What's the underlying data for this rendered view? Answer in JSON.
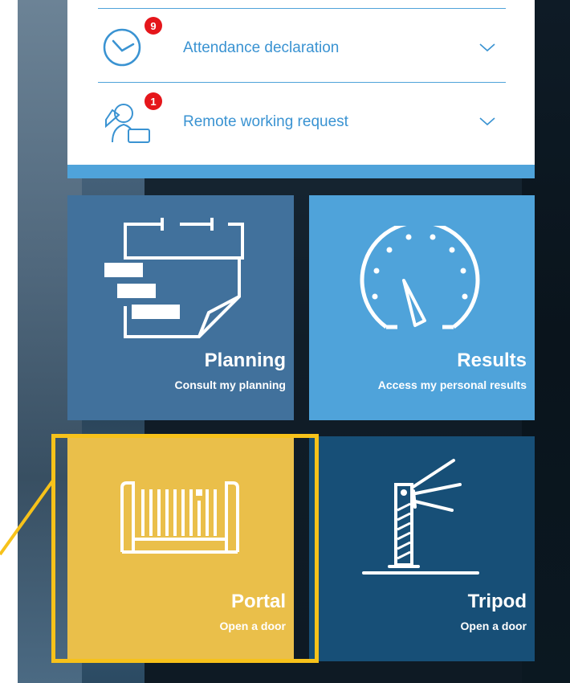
{
  "requests": [
    {
      "label": "Attendance declaration",
      "badge": "9",
      "icon": "clock-icon"
    },
    {
      "label": "Remote working request",
      "badge": "1",
      "icon": "remote-work-icon"
    }
  ],
  "tiles": [
    {
      "id": "planning",
      "title": "Planning",
      "subtitle": "Consult my planning",
      "icon": "planning-icon",
      "color": "#41719c"
    },
    {
      "id": "results",
      "title": "Results",
      "subtitle": "Access my personal results",
      "icon": "speedometer-icon",
      "color": "#4fa3da"
    },
    {
      "id": "portal",
      "title": "Portal",
      "subtitle": "Open a door",
      "icon": "gate-icon",
      "color": "#eabf4a"
    },
    {
      "id": "tripod",
      "title": "Tripod",
      "subtitle": "Open a door",
      "icon": "barrier-icon",
      "color": "#174f77"
    }
  ],
  "colors": {
    "accent": "#4fa3da",
    "badge": "#e5161b",
    "highlight": "#f7c21a"
  }
}
